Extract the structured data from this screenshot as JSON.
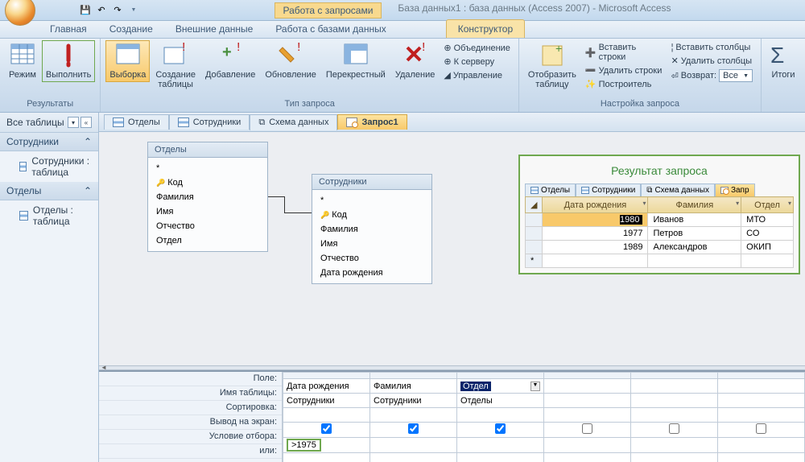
{
  "titlebar": {
    "tools_context": "Работа с запросами",
    "title": "База данных1 : база данных (Access 2007) - Microsoft Access"
  },
  "tabs": {
    "home": "Главная",
    "create": "Создание",
    "external": "Внешние данные",
    "dbtools": "Работа с базами данных",
    "design": "Конструктор"
  },
  "ribbon": {
    "results": {
      "view": "Режим",
      "run": "Выполнить",
      "group": "Результаты"
    },
    "qtype": {
      "select": "Выборка",
      "maketable": "Создание\nтаблицы",
      "append": "Добавление",
      "update": "Обновление",
      "crosstab": "Перекрестный",
      "delete": "Удаление",
      "group": "Тип запроса"
    },
    "qtype_small": {
      "union": "Объединение",
      "passthrough": "К серверу",
      "datadef": "Управление"
    },
    "show": {
      "showtable": "Отобразить\nтаблицу",
      "group": "Настройка запроса"
    },
    "rows": {
      "insert_rows": "Вставить строки",
      "delete_rows": "Удалить строки",
      "builder": "Построитель",
      "insert_cols": "Вставить столбцы",
      "delete_cols": "Удалить столбцы",
      "return_label": "Возврат:",
      "return_value": "Все"
    },
    "totals": {
      "sigma": "Итоги"
    }
  },
  "nav": {
    "header": "Все таблицы",
    "sec1": "Сотрудники",
    "sec1_item": "Сотрудники : таблица",
    "sec2": "Отделы",
    "sec2_item": "Отделы : таблица"
  },
  "doctabs": [
    "Отделы",
    "Сотрудники",
    "Схема данных",
    "Запрос1"
  ],
  "designer": {
    "t1": {
      "name": "Отделы",
      "star": "*",
      "f": [
        "Код",
        "Фамилия",
        "Имя",
        "Отчество",
        "Отдел"
      ]
    },
    "t2": {
      "name": "Сотрудники",
      "star": "*",
      "f": [
        "Код",
        "Фамилия",
        "Имя",
        "Отчество",
        "Дата рождения"
      ]
    }
  },
  "result": {
    "title": "Результат запроса",
    "tabs": [
      "Отделы",
      "Сотрудники",
      "Схема данных",
      "Запр"
    ],
    "cols": [
      "Дата рождения",
      "Фамилия",
      "Отдел"
    ],
    "rows": [
      {
        "y": "1980",
        "n": "Иванов",
        "d": "МТО"
      },
      {
        "y": "1977",
        "n": "Петров",
        "d": "СО"
      },
      {
        "y": "1989",
        "n": "Александров",
        "d": "ОКИП"
      }
    ]
  },
  "qbe": {
    "labels": [
      "Поле:",
      "Имя таблицы:",
      "Сортировка:",
      "Вывод на экран:",
      "Условие отбора:",
      "или:"
    ],
    "c0": {
      "field": "Дата рождения",
      "table": "Сотрудники",
      "criteria": ">1975"
    },
    "c1": {
      "field": "Фамилия",
      "table": "Сотрудники"
    },
    "c2": {
      "field": "Отдел",
      "table": "Отделы"
    }
  }
}
